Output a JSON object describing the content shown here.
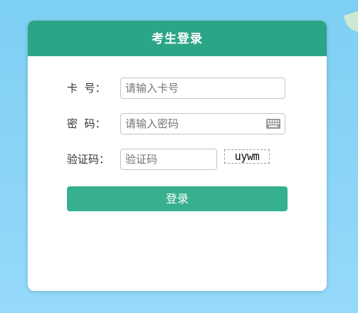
{
  "login_form": {
    "title": "考生登录",
    "card_number": {
      "label": "卡  号：",
      "placeholder": "请输入卡号",
      "value": ""
    },
    "password": {
      "label": "密  码：",
      "placeholder": "请输入密码",
      "value": "",
      "keyboard_icon": "keyboard-icon"
    },
    "captcha": {
      "label": "验证码：",
      "placeholder": "验证码",
      "value": "",
      "image_text": "uywm"
    },
    "submit_label": "登录"
  },
  "colors": {
    "header": "#2ba587",
    "button": "#36b08f",
    "background": "#86d2f5"
  }
}
